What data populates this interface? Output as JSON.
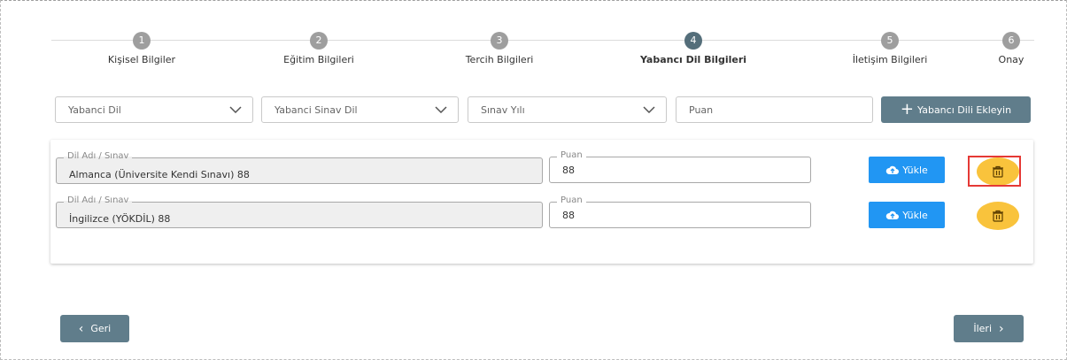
{
  "stepper": {
    "steps": [
      {
        "number": "1",
        "label": "Kişisel Bilgiler",
        "active": false
      },
      {
        "number": "2",
        "label": "Eğitim Bilgileri",
        "active": false
      },
      {
        "number": "3",
        "label": "Tercih Bilgileri",
        "active": false
      },
      {
        "number": "4",
        "label": "Yabancı Dil Bilgileri",
        "active": true
      },
      {
        "number": "5",
        "label": "İletişim Bilgileri",
        "active": false
      },
      {
        "number": "6",
        "label": "Onay",
        "active": false
      }
    ]
  },
  "filters": {
    "language_select": "Yabanci Dil",
    "exam_select": "Yabanci Sinav Dil",
    "year_select": "Sınav Yılı",
    "score_placeholder": "Puan",
    "add_button": "Yabancı Dili Ekleyin"
  },
  "entries": [
    {
      "name_legend": "Dil Adı / Sınav",
      "name_value": "Almanca (Üniversite Kendi Sınavı) 88",
      "score_legend": "Puan",
      "score_value": "88",
      "upload_label": "Yükle"
    },
    {
      "name_legend": "Dil Adı / Sınav",
      "name_value": "İngilizce (YÖKDİL) 88",
      "score_legend": "Puan",
      "score_value": "88",
      "upload_label": "Yükle"
    }
  ],
  "nav": {
    "back_label": "Geri",
    "next_label": "İleri"
  },
  "colors": {
    "primary": "#607d8b",
    "upload": "#2196f3",
    "delete": "#f9c33c",
    "highlight": "#e53935"
  },
  "icons": {
    "upload": "cloud-upload-icon",
    "delete": "trash-icon",
    "add": "plus-icon"
  }
}
